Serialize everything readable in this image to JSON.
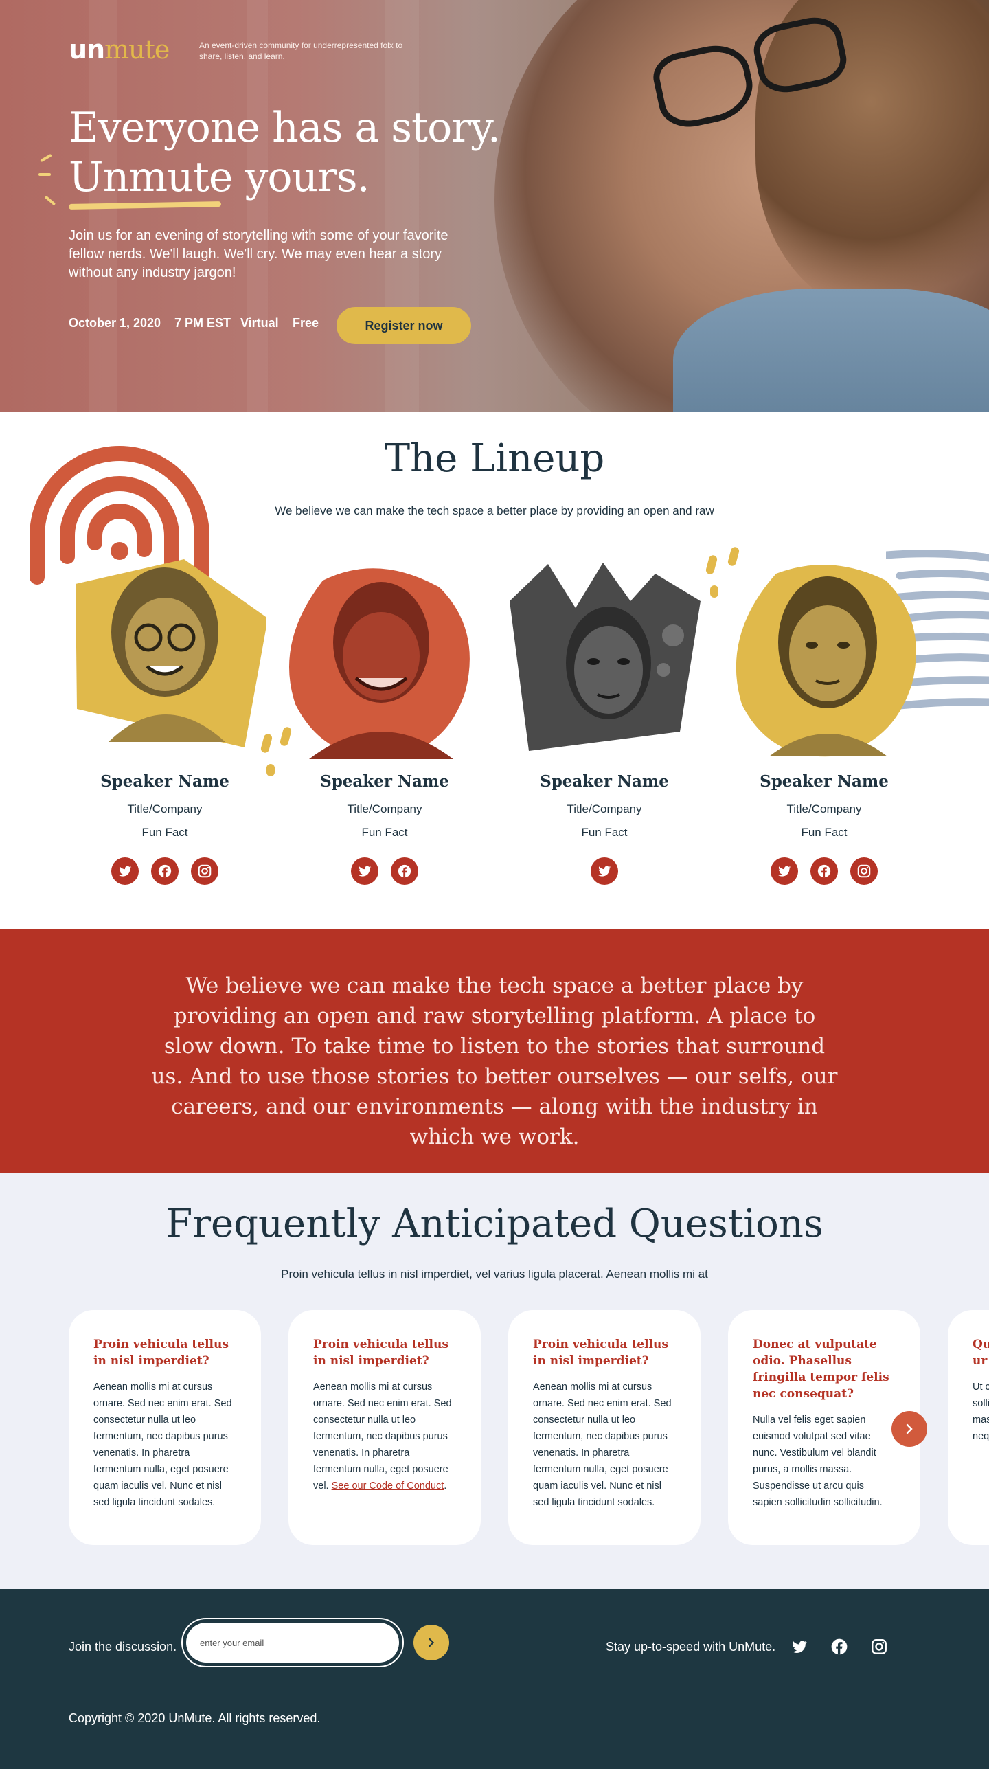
{
  "brand": {
    "logo_un": "un",
    "logo_mute": "mute",
    "tagline": "An event-driven community for underrepresented folx to share, listen, and learn."
  },
  "hero": {
    "title_line1": "Everyone has a story.",
    "title_line2": "Unmute yours.",
    "description": "Join us for an evening of storytelling with some of your favorite fellow nerds. We'll laugh. We'll cry. We may even hear a story without any industry jargon!",
    "date": "October 1, 2020",
    "time": "7 PM EST",
    "location": "Virtual",
    "price": "Free",
    "register_label": "Register now"
  },
  "lineup": {
    "title": "The Lineup",
    "subtitle": "We believe we can make the tech space a better place by providing an open and raw",
    "speakers": [
      {
        "name": "Speaker Name",
        "title": "Title/Company",
        "fact": "Fun Fact",
        "socials": [
          "twitter-icon",
          "facebook-icon",
          "instagram-icon"
        ]
      },
      {
        "name": "Speaker Name",
        "title": "Title/Company",
        "fact": "Fun Fact",
        "socials": [
          "twitter-icon",
          "facebook-icon"
        ]
      },
      {
        "name": "Speaker Name",
        "title": "Title/Company",
        "fact": "Fun Fact",
        "socials": [
          "twitter-icon"
        ]
      },
      {
        "name": "Speaker Name",
        "title": "Title/Company",
        "fact": "Fun Fact",
        "socials": [
          "twitter-icon",
          "facebook-icon",
          "instagram-icon"
        ]
      }
    ]
  },
  "quote": {
    "text": "We believe we can make the tech space a better place by providing an open and raw storytelling platform. A place to slow down. To take time to listen to the stories that surround us. And to use those stories to better ourselves — our selfs, our careers, and our environments — along with the industry in which we work."
  },
  "faq": {
    "title": "Frequently Anticipated Questions",
    "subtitle": "Proin vehicula tellus in nisl imperdiet, vel varius ligula placerat. Aenean mollis mi at",
    "cards": [
      {
        "question": "Proin vehicula tellus in nisl imperdiet?",
        "answer": "Aenean mollis mi at cursus ornare. Sed nec enim erat. Sed consectetur nulla ut leo fermentum, nec dapibus purus venenatis. In pharetra fermentum nulla, eget posuere quam iaculis vel. Nunc et nisl sed ligula tincidunt sodales.",
        "link": ""
      },
      {
        "question": "Proin vehicula tellus in nisl imperdiet?",
        "answer": "Aenean mollis mi at cursus ornare. Sed nec enim erat. Sed consectetur nulla ut leo fermentum, nec dapibus purus venenatis. In pharetra fermentum nulla, eget posuere vel.",
        "link": "See our Code of Conduct"
      },
      {
        "question": "Proin vehicula tellus in nisl imperdiet?",
        "answer": "Aenean mollis mi at cursus ornare. Sed nec enim erat. Sed consectetur nulla ut leo fermentum, nec dapibus purus venenatis. In pharetra fermentum nulla, eget posuere quam iaculis vel. Nunc et nisl sed ligula tincidunt sodales.",
        "link": ""
      },
      {
        "question": "Donec at vulputate odio. Phasellus fringilla tempor felis nec consequat?",
        "answer": "Nulla vel felis eget sapien euismod volutpat sed vitae nunc. Vestibulum vel blandit purus, a mollis massa. Suspendisse ut arcu quis sapien sollicitudin sollicitudin.",
        "link": ""
      },
      {
        "question": "Qu ur",
        "answer": "Ut c solli mas neq",
        "link": ""
      }
    ]
  },
  "footer": {
    "join_label": "Join the discussion.",
    "email_placeholder": "enter your email",
    "stay_label": "Stay up-to-speed with UnMute.",
    "copyright": "Copyright © 2020 UnMute. All rights reserved."
  },
  "colors": {
    "red": "#b53325",
    "gold": "#e0b94b",
    "navy": "#1e3741",
    "ink": "#1f3340",
    "faq_bg": "#eef0f7"
  }
}
